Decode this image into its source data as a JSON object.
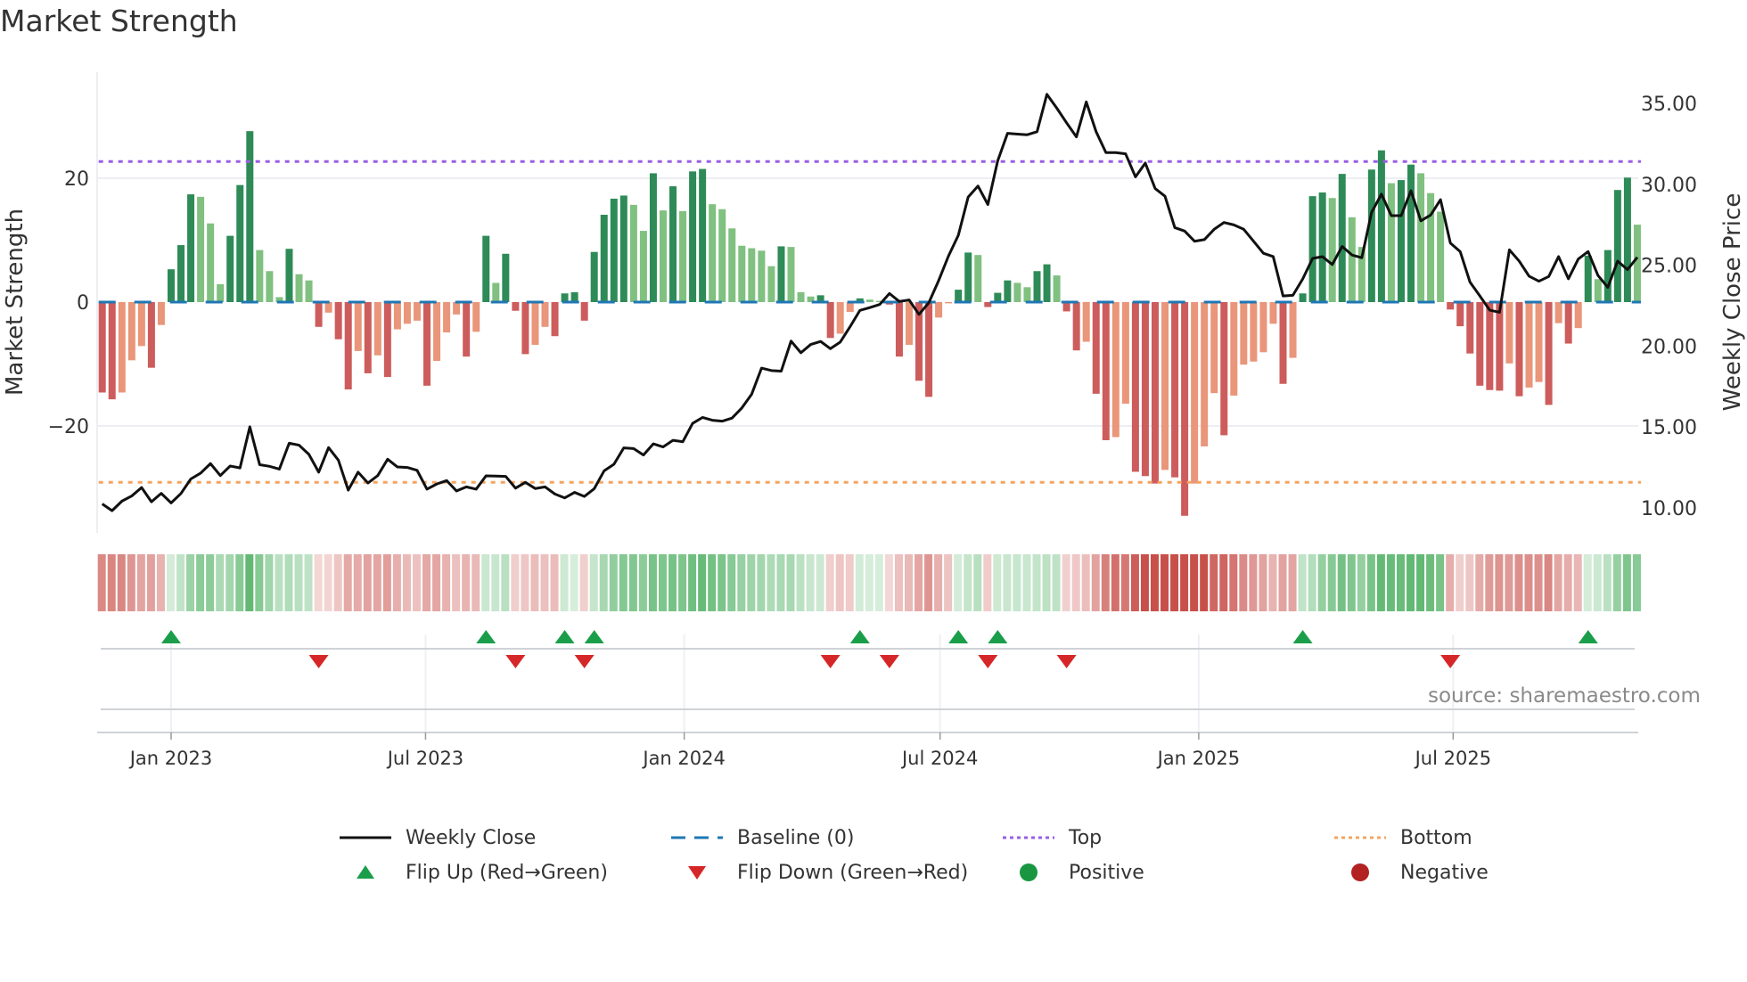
{
  "title": "Market Strength",
  "source": "source: sharemaestro.com",
  "chart_data": {
    "type": "bar",
    "title": "Market Strength",
    "interval": "weekly",
    "start_week": "2022-11-13",
    "ylabel_left": "Market Strength",
    "ylabel_right": "Weekly Close Price",
    "left_ylim": [
      -36,
      40
    ],
    "right_ylim": [
      8.5,
      36
    ],
    "left_ticks": [
      {
        "v": 20,
        "label": "20"
      },
      {
        "v": 0,
        "label": "0"
      },
      {
        "v": -20,
        "label": "−20"
      }
    ],
    "right_ticks": [
      {
        "v": 35,
        "label": "35.00"
      },
      {
        "v": 30,
        "label": "30.00"
      },
      {
        "v": 25,
        "label": "25.00"
      },
      {
        "v": 20,
        "label": "20.00"
      },
      {
        "v": 15,
        "label": "15.00"
      },
      {
        "v": 10,
        "label": "10.00"
      }
    ],
    "x_ticks": [
      {
        "label": "Jan 2023",
        "date": "2023-01-01"
      },
      {
        "label": "Jul 2023",
        "date": "2023-07-01"
      },
      {
        "label": "Jan 2024",
        "date": "2024-01-01"
      },
      {
        "label": "Jul 2024",
        "date": "2024-07-01"
      },
      {
        "label": "Jan 2025",
        "date": "2025-01-01"
      },
      {
        "label": "Jul 2025",
        "date": "2025-07-01"
      }
    ],
    "top_level": 22.7,
    "bottom_level": -29.1,
    "baseline": 0,
    "strength": [
      -14.6,
      -15.7,
      -14.6,
      -9.4,
      -7.1,
      -10.6,
      -3.7,
      5.3,
      9.2,
      17.4,
      17.0,
      12.7,
      2.9,
      10.7,
      18.9,
      27.6,
      8.4,
      5.0,
      0.8,
      8.6,
      4.5,
      3.5,
      -4.0,
      -1.7,
      -6.0,
      -14.1,
      -7.9,
      -11.5,
      -8.6,
      -12.1,
      -4.4,
      -3.5,
      -3.0,
      -13.5,
      -9.5,
      -4.9,
      -2.0,
      -8.8,
      -4.8,
      10.7,
      3.1,
      7.8,
      -1.4,
      -8.4,
      -6.9,
      -4.0,
      -5.5,
      1.4,
      1.6,
      -3.0,
      8.1,
      14.1,
      16.7,
      17.2,
      15.7,
      11.5,
      20.8,
      14.8,
      18.7,
      14.7,
      21.1,
      21.5,
      15.8,
      15.0,
      11.9,
      9.1,
      8.7,
      8.3,
      5.8,
      9.0,
      8.9,
      1.6,
      0.9,
      1.1,
      -5.8,
      -5.1,
      -1.6,
      0.6,
      0.4,
      0.2,
      -0.4,
      -8.8,
      -6.9,
      -12.7,
      -15.3,
      -2.5,
      -0.2,
      2.0,
      8.0,
      7.6,
      -0.8,
      1.5,
      3.5,
      3.1,
      2.4,
      5.0,
      6.1,
      4.3,
      -1.5,
      -7.8,
      -6.4,
      -14.8,
      -22.3,
      -21.8,
      -16.4,
      -27.4,
      -28.1,
      -29.3,
      -27.1,
      -28.3,
      -34.5,
      -29.3,
      -23.3,
      -14.7,
      -21.5,
      -15.1,
      -10.1,
      -9.6,
      -8.1,
      -3.5,
      -13.2,
      -9.0,
      1.4,
      17.1,
      17.7,
      16.8,
      20.7,
      13.7,
      8.9,
      21.4,
      24.5,
      19.2,
      19.7,
      22.2,
      20.8,
      17.6,
      14.6,
      -1.2,
      -3.9,
      -8.3,
      -13.5,
      -14.2,
      -14.3,
      -9.9,
      -15.2,
      -13.8,
      -12.9,
      -16.6,
      -3.4,
      -6.7,
      -4.2,
      7.5,
      3.7,
      8.4,
      18.1,
      20.1,
      12.5
    ],
    "weekly_close": [
      10.25,
      9.83,
      10.42,
      10.74,
      11.26,
      10.38,
      10.9,
      10.31,
      10.89,
      11.79,
      12.15,
      12.74,
      12.0,
      12.59,
      12.47,
      15.01,
      12.67,
      12.57,
      12.4,
      14.0,
      13.88,
      13.31,
      12.21,
      13.73,
      12.95,
      11.1,
      12.21,
      11.54,
      12.0,
      13.01,
      12.53,
      12.5,
      12.32,
      11.16,
      11.48,
      11.69,
      11.05,
      11.3,
      11.16,
      11.98,
      11.97,
      11.95,
      11.22,
      11.58,
      11.2,
      11.3,
      10.86,
      10.62,
      10.96,
      10.71,
      11.19,
      12.29,
      12.7,
      13.71,
      13.67,
      13.27,
      13.96,
      13.77,
      14.18,
      14.09,
      15.23,
      15.59,
      15.42,
      15.36,
      15.55,
      16.18,
      17.03,
      18.64,
      18.49,
      18.45,
      20.31,
      19.59,
      20.1,
      20.29,
      19.84,
      20.25,
      21.2,
      22.21,
      22.38,
      22.57,
      23.25,
      22.76,
      22.85,
      21.96,
      22.68,
      24.05,
      25.57,
      26.85,
      29.21,
      29.89,
      28.75,
      31.45,
      33.15,
      33.1,
      33.06,
      33.25,
      35.56,
      34.71,
      33.8,
      32.93,
      35.09,
      33.25,
      31.96,
      31.96,
      31.88,
      30.46,
      31.31,
      29.74,
      29.26,
      27.32,
      27.11,
      26.48,
      26.58,
      27.22,
      27.64,
      27.49,
      27.22,
      26.48,
      25.74,
      25.53,
      23.1,
      23.14,
      24.15,
      25.42,
      25.53,
      25.04,
      26.16,
      25.63,
      25.46,
      28.27,
      29.39,
      28.06,
      28.06,
      29.6,
      27.74,
      28.1,
      29.05,
      26.37,
      25.84,
      23.95,
      23.1,
      22.22,
      22.09,
      25.95,
      25.25,
      24.32,
      24.01,
      24.3,
      25.53,
      24.16,
      25.38,
      25.84,
      24.37,
      23.63,
      25.25,
      24.73,
      25.49
    ],
    "colors": {
      "pos_strong": "#2e8b57",
      "pos_weak": "#80c080",
      "neg_strong": "#cd5c5c",
      "neg_weak": "#e9967a",
      "line": "#111111",
      "baseline": "#1f77b4",
      "top": "#9b5de5",
      "bottom": "#f4a460",
      "flip_up": "#1a9e4a",
      "flip_down": "#d62728",
      "heat_pos": "#4caf60",
      "heat_neg": "#c8504a",
      "positive": "#1a9641",
      "negative": "#b22222"
    },
    "legend": [
      {
        "key": "line",
        "label": "Weekly Close"
      },
      {
        "key": "baseline",
        "label": "Baseline (0)"
      },
      {
        "key": "top",
        "label": "Top"
      },
      {
        "key": "bottom",
        "label": "Bottom"
      },
      {
        "key": "flip_up",
        "label": "Flip Up (Red→Green)"
      },
      {
        "key": "flip_down",
        "label": "Flip Down (Green→Red)"
      },
      {
        "key": "positive",
        "label": "Positive"
      },
      {
        "key": "negative",
        "label": "Negative"
      }
    ]
  }
}
